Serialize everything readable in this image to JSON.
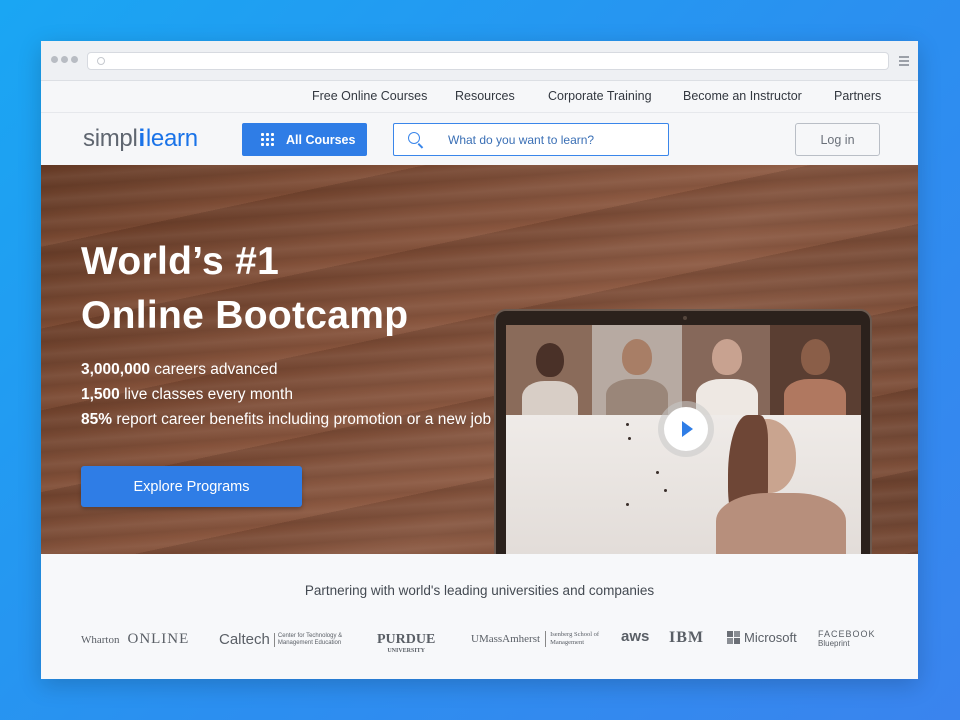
{
  "topnav": {
    "items": [
      {
        "label": "Free Online Courses"
      },
      {
        "label": "Resources"
      },
      {
        "label": "Corporate Training"
      },
      {
        "label": "Become an Instructor"
      },
      {
        "label": "Partners"
      }
    ]
  },
  "header": {
    "logo": {
      "part1": "simpl",
      "sep": "i",
      "part2": "learn"
    },
    "all_courses_label": "All Courses",
    "search_placeholder": "What do you want to learn?",
    "login_label": "Log in"
  },
  "hero": {
    "title_line1": "World’s #1",
    "title_line2": "Online Bootcamp",
    "stats": [
      {
        "value": "3,000,000",
        "text": " careers advanced"
      },
      {
        "value": "1,500",
        "text": " live classes every month"
      },
      {
        "value": "85%",
        "text": " report career benefits including promotion or a new job"
      }
    ],
    "cta_label": "Explore Programs"
  },
  "partners": {
    "title": "Partnering with world's leading universities and companies",
    "logos": [
      {
        "name": "Wharton",
        "suffix": "ONLINE"
      },
      {
        "name": "Caltech",
        "sub": "Center for Technology & Management Education"
      },
      {
        "name": "PURDUE",
        "sub": "UNIVERSITY"
      },
      {
        "name": "UMassAmherst",
        "sub": "Isenberg School of Management"
      },
      {
        "name": "aws"
      },
      {
        "name": "IBM"
      },
      {
        "name": "Microsoft"
      },
      {
        "name": "FACEBOOK",
        "sub": "Blueprint"
      }
    ]
  },
  "colors": {
    "accent": "#2f7de6",
    "background": "#1aa6f3",
    "hero_wood": "#7a4a34"
  }
}
